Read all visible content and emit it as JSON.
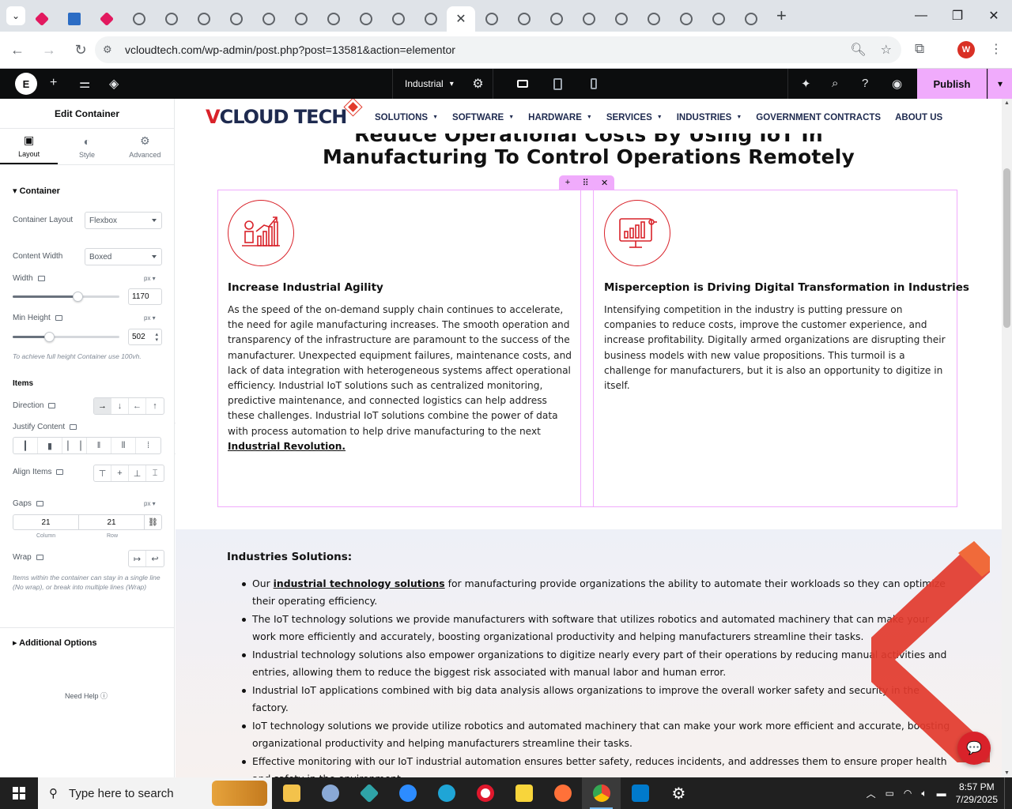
{
  "browser": {
    "url": "vcloudtech.com/wp-admin/post.php?post=13581&action=elementor",
    "tab_count_icons": 26,
    "active_tab_close": "✕",
    "new_tab": "+",
    "profile_initial": "W"
  },
  "elementor": {
    "page_name": "Industrial",
    "publish_label": "Publish",
    "accent": "#f0abfc"
  },
  "panel": {
    "title": "Edit Container",
    "tabs": [
      {
        "label": "Layout",
        "icon": "layout-icon"
      },
      {
        "label": "Style",
        "icon": "style-icon"
      },
      {
        "label": "Advanced",
        "icon": "gear-icon"
      }
    ],
    "container_section": "Container",
    "container_layout": {
      "label": "Container Layout",
      "value": "Flexbox"
    },
    "content_width": {
      "label": "Content Width",
      "value": "Boxed"
    },
    "width": {
      "label": "Width",
      "unit": "px",
      "value": "1170"
    },
    "min_height": {
      "label": "Min Height",
      "unit": "px",
      "value": "502"
    },
    "min_height_hint": "To achieve full height Container use 100vh.",
    "items_section": "Items",
    "direction": {
      "label": "Direction"
    },
    "justify": {
      "label": "Justify Content"
    },
    "align": {
      "label": "Align Items"
    },
    "gaps": {
      "label": "Gaps",
      "unit": "px",
      "column": "21",
      "row": "21",
      "column_label": "Column",
      "row_label": "Row"
    },
    "wrap": {
      "label": "Wrap"
    },
    "wrap_hint": "Items within the container can stay in a single line (No wrap), or break into multiple lines (Wrap)",
    "additional_options": "Additional Options",
    "need_help": "Need Help"
  },
  "site": {
    "logo_v": "V",
    "logo_cloud": "CLOUD",
    "logo_tech": " TECH",
    "menu": [
      {
        "label": "SOLUTIONS",
        "caret": true
      },
      {
        "label": "SOFTWARE",
        "caret": true
      },
      {
        "label": "HARDWARE",
        "caret": true
      },
      {
        "label": "SERVICES",
        "caret": true
      },
      {
        "label": "INDUSTRIES",
        "caret": true
      },
      {
        "label": "GOVERNMENT CONTRACTS",
        "caret": false
      },
      {
        "label": "ABOUT US",
        "caret": false
      }
    ],
    "hero_line1": "Reduce Operational Costs By Using IoT In",
    "hero_line2": "Manufacturing To Control Operations Remotely",
    "cards": [
      {
        "title": "Increase Industrial Agility",
        "text": "As the speed of the on-demand supply chain continues to accelerate, the need for agile manufacturing increases. The smooth operation and transparency of the infrastructure are paramount to the success of the manufacturer. Unexpected equipment failures, maintenance costs, and lack of data integration with heterogeneous systems affect operational efficiency. Industrial IoT solutions such as centralized monitoring, predictive maintenance, and connected logistics can help address these challenges. Industrial IoT solutions combine the power of data with process automation to help drive manufacturing to the next ",
        "link": "Industrial Revolution."
      },
      {
        "title": "Misperception is Driving Digital Transformation in Industries",
        "text": "Intensifying competition in the industry is putting pressure on companies to reduce costs, improve the customer experience, and increase profitability. Digitally armed organizations are disrupting their business models with new value propositions. This turmoil is a challenge for manufacturers, but it is also an opportunity to digitize in itself."
      }
    ],
    "solutions_title": "Industries Solutions:",
    "solutions": [
      {
        "pre": "Our ",
        "link": "industrial technology solutions",
        "post": " for manufacturing provide organizations the ability to automate their workloads so they can optimize their operating efficiency."
      },
      {
        "pre": "The IoT technology solutions we provide manufacturers with software that utilizes robotics and automated machinery that can make your work more efficiently and accurately, boosting organizational productivity and helping manufacturers streamline their tasks.",
        "link": "",
        "post": ""
      },
      {
        "pre": "Industrial technology solutions also empower organizations to digitize nearly every part of their operations by reducing manual activities and entries, allowing them to reduce the biggest risk associated with manual labor and human error.",
        "link": "",
        "post": ""
      },
      {
        "pre": "Industrial IoT applications combined with big data analysis allows organizations to improve the overall worker safety and security in the factory.",
        "link": "",
        "post": ""
      },
      {
        "pre": "IoT technology solutions we provide utilize robotics and automated machinery that can make your work more efficient and accurate, boosting organizational productivity and helping manufacturers streamline their tasks.",
        "link": "",
        "post": ""
      },
      {
        "pre": "Effective monitoring with our IoT industrial automation ensures better safety, reduces incidents, and addresses them to ensure proper health and safety in the environment.",
        "link": "",
        "post": ""
      }
    ],
    "brand_red": "#d9222a",
    "brand_navy": "#1e2a4f"
  },
  "taskbar": {
    "search_placeholder": "Type here to search",
    "time": "8:57 PM",
    "date": "7/29/2025"
  }
}
